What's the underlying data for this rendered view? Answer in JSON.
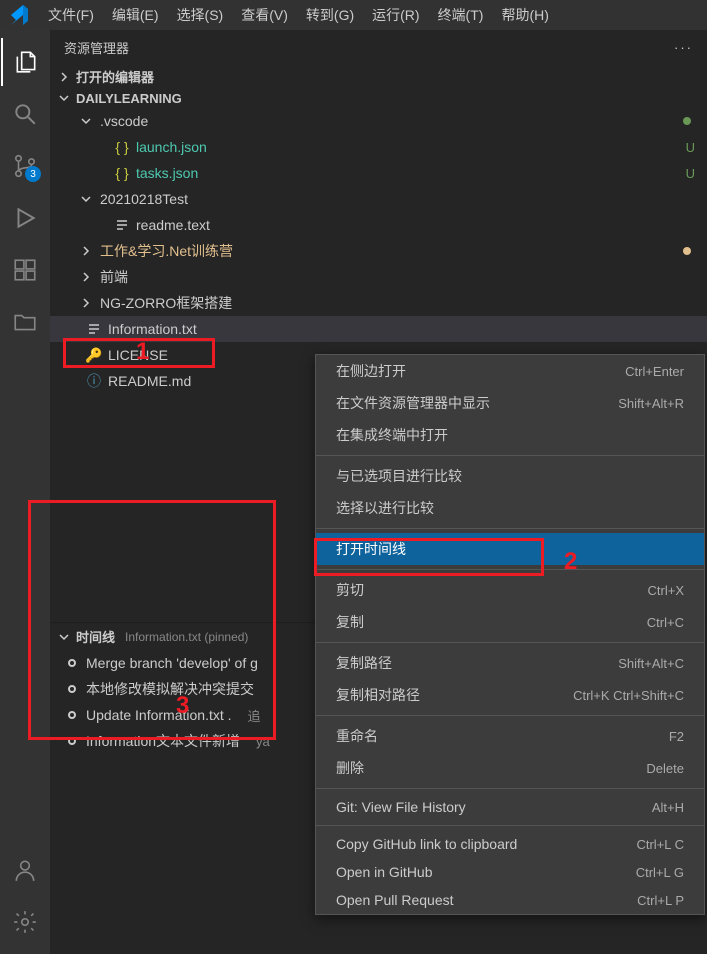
{
  "menubar": {
    "items": [
      "文件(F)",
      "编辑(E)",
      "选择(S)",
      "查看(V)",
      "转到(G)",
      "运行(R)",
      "终端(T)",
      "帮助(H)"
    ]
  },
  "activityBar": {
    "scmBadge": "3"
  },
  "sidebar": {
    "title": "资源管理器",
    "sections": {
      "openEditors": "打开的编辑器",
      "project": "DAILYLEARNING"
    },
    "tree": [
      {
        "label": ".vscode",
        "type": "folder",
        "indent": 1,
        "expanded": true,
        "status": "green-dot"
      },
      {
        "label": "launch.json",
        "type": "json",
        "indent": 2,
        "status": "U"
      },
      {
        "label": "tasks.json",
        "type": "json",
        "indent": 2,
        "status": "U"
      },
      {
        "label": "20210218Test",
        "type": "folder",
        "indent": 1,
        "expanded": true
      },
      {
        "label": "readme.text",
        "type": "text",
        "indent": 2
      },
      {
        "label": "工作&学习.Net训练营",
        "type": "folder",
        "indent": 1,
        "expanded": false,
        "color": "orange",
        "status": "orange-dot"
      },
      {
        "label": "前端",
        "type": "folder",
        "indent": 1,
        "expanded": false
      },
      {
        "label": "NG-ZORRO框架搭建",
        "type": "folder",
        "indent": 1,
        "expanded": false
      },
      {
        "label": "Information.txt",
        "type": "text",
        "indent": 0,
        "selected": true
      },
      {
        "label": "LICENSE",
        "type": "license",
        "indent": 0
      },
      {
        "label": "README.md",
        "type": "info",
        "indent": 0
      }
    ]
  },
  "timeline": {
    "title": "时间线",
    "subtitle": "Information.txt (pinned)",
    "items": [
      {
        "label": "Merge branch 'develop' of g"
      },
      {
        "label": "本地修改模拟解决冲突提交"
      },
      {
        "label": "Update Information.txt .",
        "meta": "追"
      },
      {
        "label": "Information文本文件新增",
        "meta": "ya"
      }
    ]
  },
  "contextMenu": {
    "groups": [
      [
        {
          "label": "在侧边打开",
          "shortcut": "Ctrl+Enter"
        },
        {
          "label": "在文件资源管理器中显示",
          "shortcut": "Shift+Alt+R"
        },
        {
          "label": "在集成终端中打开",
          "shortcut": ""
        }
      ],
      [
        {
          "label": "与已选项目进行比较",
          "shortcut": ""
        },
        {
          "label": "选择以进行比较",
          "shortcut": ""
        }
      ],
      [
        {
          "label": "打开时间线",
          "shortcut": "",
          "highlighted": true
        }
      ],
      [
        {
          "label": "剪切",
          "shortcut": "Ctrl+X"
        },
        {
          "label": "复制",
          "shortcut": "Ctrl+C"
        }
      ],
      [
        {
          "label": "复制路径",
          "shortcut": "Shift+Alt+C"
        },
        {
          "label": "复制相对路径",
          "shortcut": "Ctrl+K Ctrl+Shift+C"
        }
      ],
      [
        {
          "label": "重命名",
          "shortcut": "F2"
        },
        {
          "label": "删除",
          "shortcut": "Delete"
        }
      ],
      [
        {
          "label": "Git: View File History",
          "shortcut": "Alt+H"
        }
      ],
      [
        {
          "label": "Copy GitHub link to clipboard",
          "shortcut": "Ctrl+L C"
        },
        {
          "label": "Open in GitHub",
          "shortcut": "Ctrl+L G"
        },
        {
          "label": "Open Pull Request",
          "shortcut": "Ctrl+L P"
        }
      ]
    ]
  },
  "annotations": {
    "one": "1",
    "two": "2",
    "three": "3"
  }
}
